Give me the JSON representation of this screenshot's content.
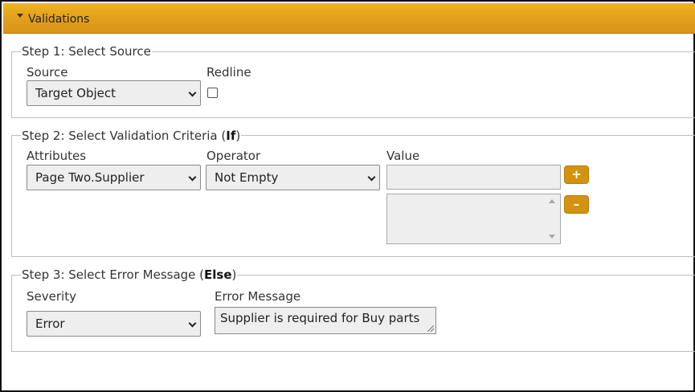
{
  "header": {
    "title": "Validations"
  },
  "step1": {
    "legend": "Step 1: Select Source",
    "source_label": "Source",
    "source_value": "Target Object",
    "redline_label": "Redline",
    "redline_checked": false
  },
  "step2": {
    "legend_prefix": "Step 2: Select Validation Criteria (",
    "legend_keyword": "If",
    "legend_suffix": ")",
    "attributes_label": "Attributes",
    "attributes_value": "Page Two.Supplier",
    "operator_label": "Operator",
    "operator_value": "Not Empty",
    "value_label": "Value",
    "value_input": "",
    "add_label": "+",
    "remove_label": "–"
  },
  "step3": {
    "legend_prefix": "Step 3: Select Error Message (",
    "legend_keyword": "Else",
    "legend_suffix": ")",
    "severity_label": "Severity",
    "severity_value": "Error",
    "message_label": "Error Message",
    "message_value": "Supplier is required for Buy parts"
  },
  "colors": {
    "header": "#e4a21c",
    "button": "#d4920e"
  }
}
